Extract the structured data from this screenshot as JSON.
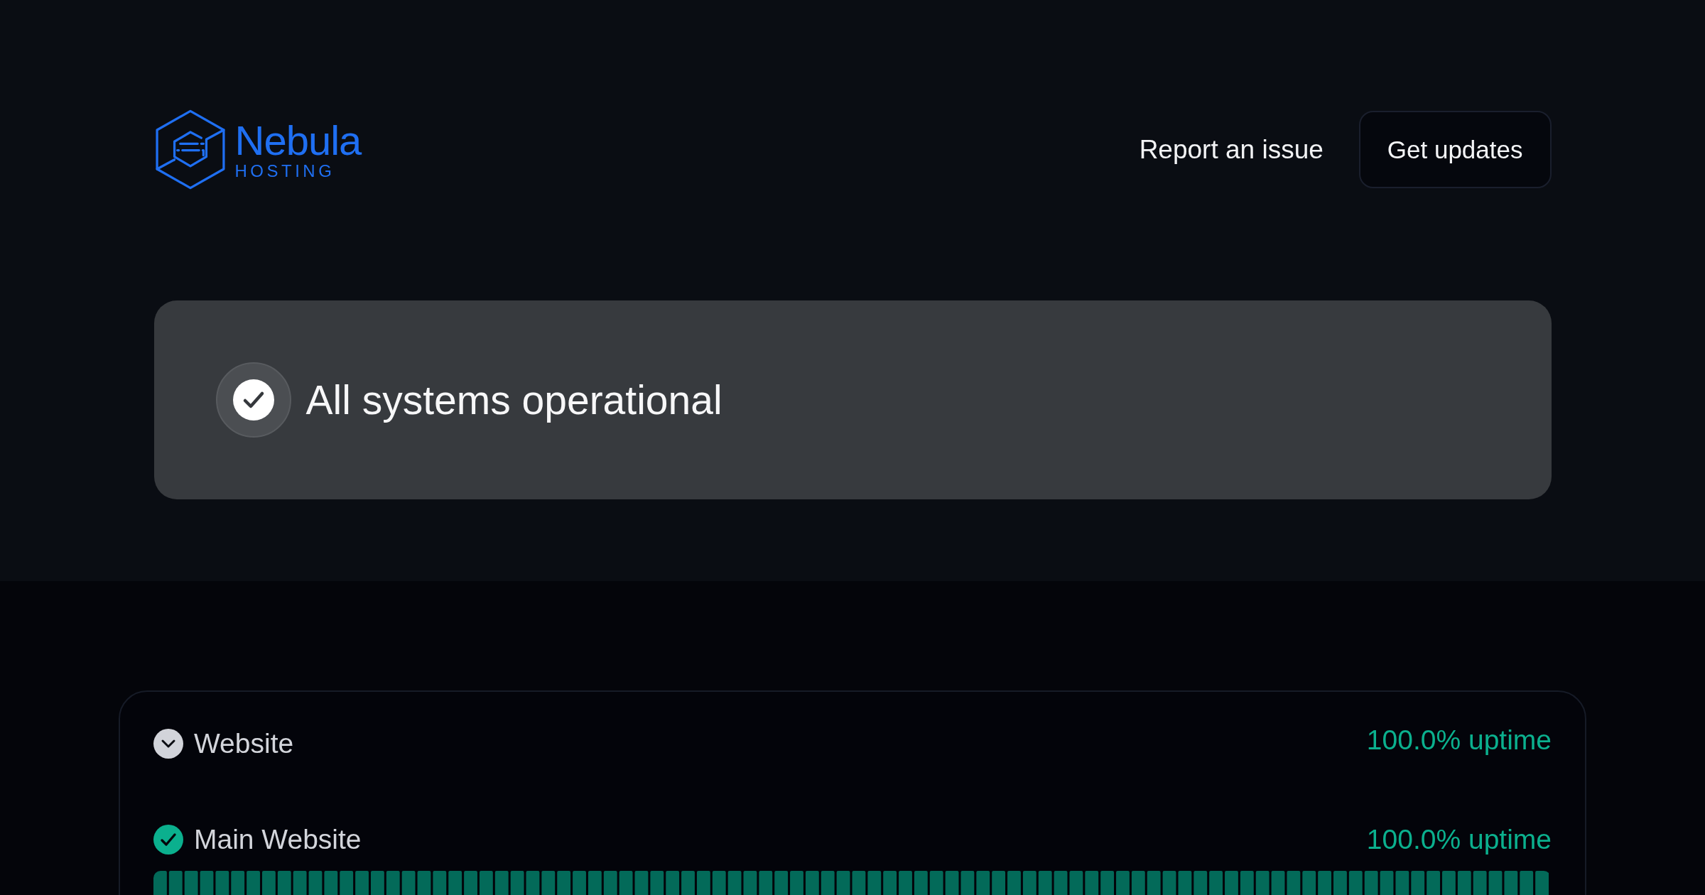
{
  "header": {
    "logo": {
      "name": "Nebula",
      "tagline": "HOSTING"
    },
    "link": "Report an issue",
    "button": "Get updates"
  },
  "status_banner": {
    "title": "All systems operational",
    "operational": true
  },
  "components": [
    {
      "name": "Website",
      "uptime": "100.0% uptime",
      "expanded": true,
      "children": [
        {
          "name": "Main Website",
          "uptime": "100.0% uptime",
          "operational": true
        }
      ]
    }
  ]
}
